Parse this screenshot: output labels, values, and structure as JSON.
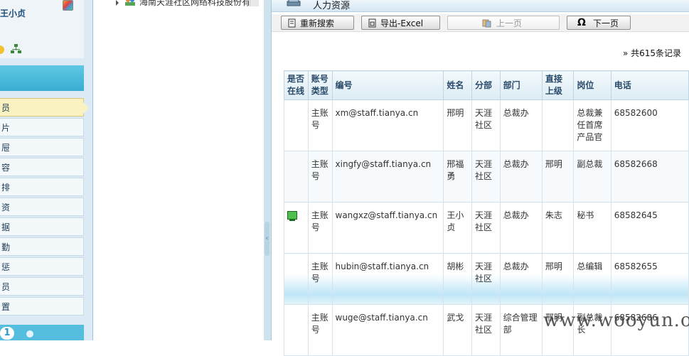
{
  "sidebar": {
    "user_name": "王小贞",
    "items": [
      {
        "label": "员",
        "active": true
      },
      {
        "label": "片"
      },
      {
        "label": "屉"
      },
      {
        "label": "容"
      },
      {
        "label": "排"
      },
      {
        "label": "资"
      },
      {
        "label": "据"
      },
      {
        "label": "勤"
      },
      {
        "label": "惩"
      },
      {
        "label": "员"
      },
      {
        "label": "置"
      }
    ],
    "page_number": "1"
  },
  "tree": {
    "root_label": "海南天涯社区网络科技股份有"
  },
  "main": {
    "title": "人力资源",
    "toolbar": {
      "research_label": "重新搜索",
      "export_label": "导出-Excel",
      "prev_label": "上一页",
      "next_label": "下一页"
    },
    "record_count": "» 共615条记录"
  },
  "table": {
    "headers": {
      "online": "是否在线",
      "acct_type": "账号类型",
      "id": "编号",
      "name": "姓名",
      "branch": "分部",
      "dept": "部门",
      "manager": "直接上级",
      "position": "岗位",
      "phone": "电话"
    },
    "rows": [
      {
        "online": false,
        "acct_type": "主账号",
        "id": "xm@staff.tianya.cn",
        "name": "邢明",
        "branch": "天涯社区",
        "dept": "总裁办",
        "manager": "",
        "position": "总裁兼任首席产品官",
        "phone": "68582600"
      },
      {
        "online": false,
        "acct_type": "主账号",
        "id": "xingfy@staff.tianya.cn",
        "name": "邢福勇",
        "branch": "天涯社区",
        "dept": "总裁办",
        "manager": "邢明",
        "position": "副总裁",
        "phone": "68582668"
      },
      {
        "online": true,
        "acct_type": "主账号",
        "id": "wangxz@staff.tianya.cn",
        "name": "王小贞",
        "branch": "天涯社区",
        "dept": "总裁办",
        "manager": "朱志",
        "position": "秘书",
        "phone": "68582645"
      },
      {
        "online": false,
        "acct_type": "主账号",
        "id": "hubin@staff.tianya.cn",
        "name": "胡彬",
        "branch": "天涯社区",
        "dept": "总裁办",
        "manager": "邢明",
        "position": "总编辑",
        "phone": "68582655"
      },
      {
        "online": false,
        "acct_type": "主账号",
        "id": "wuge@staff.tianya.cn",
        "name": "武戈",
        "branch": "天涯社区",
        "dept": "综合管理部",
        "manager": "邢明",
        "position": "副总裁长",
        "phone": "68582686"
      }
    ]
  },
  "watermark": "www.wooyun.org"
}
